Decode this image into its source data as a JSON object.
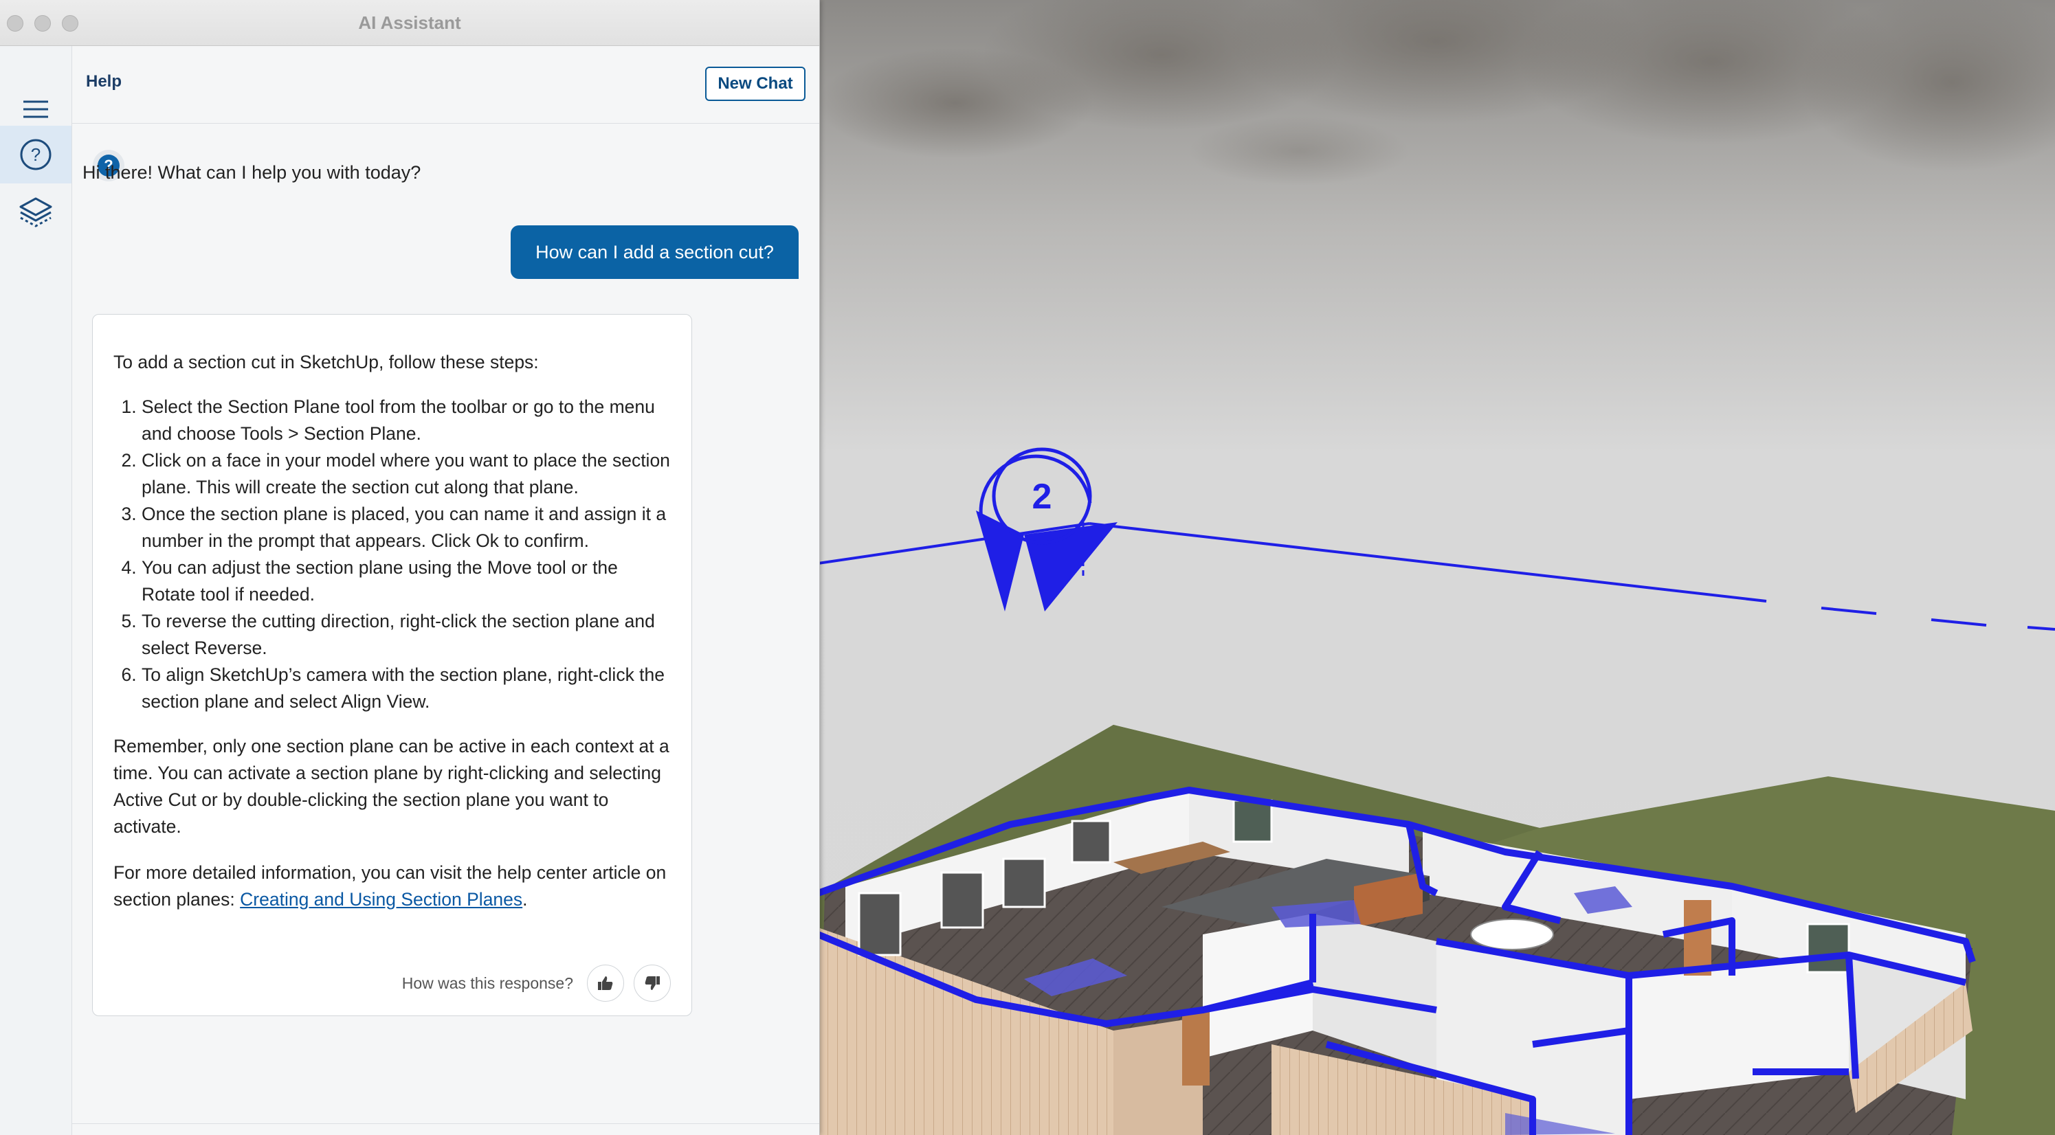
{
  "window": {
    "title": "AI Assistant"
  },
  "siderail": {
    "items": [
      {
        "icon": "menu-icon"
      },
      {
        "icon": "help-circle-icon",
        "active": true
      },
      {
        "icon": "layers-icon"
      }
    ]
  },
  "panel": {
    "title": "Help",
    "new_chat_label": "New Chat"
  },
  "conversation": {
    "greeting": "Hi there! What can I help you with today?",
    "user_message": "How can I add a section cut?",
    "answer": {
      "intro": "To add a section cut in SketchUp, follow these steps:",
      "steps": [
        "Select the Section Plane tool from the toolbar or go to the menu and choose Tools > Section Plane.",
        "Click on a face in your model where you want to place the section plane. This will create the section cut along that plane.",
        "Once the section plane is placed, you can name it and assign it a number in the prompt that appears. Click Ok to confirm.",
        "You can adjust the section plane using the Move tool or the Rotate tool if needed.",
        "To reverse the cutting direction, right-click the section plane and select Reverse.",
        "To align SketchUp’s camera with the section plane, right-click the section plane and select Align View."
      ],
      "remember": "Remember, only one section plane can be active in each context at a time. You can activate a section plane by right-clicking and selecting Active Cut or by double-clicking the section plane you want to activate.",
      "more_info_prefix": "For more detailed information, you can visit the help center article on section planes: ",
      "link_text": "Creating and Using Section Planes",
      "more_info_suffix": "."
    },
    "feedback_label": "How was this response?"
  },
  "viewport": {
    "section_marker_label": "2",
    "colors": {
      "section_blue": "#1f1fe6",
      "ground": "#6e7a49",
      "sky": "#d4d4d4"
    }
  }
}
